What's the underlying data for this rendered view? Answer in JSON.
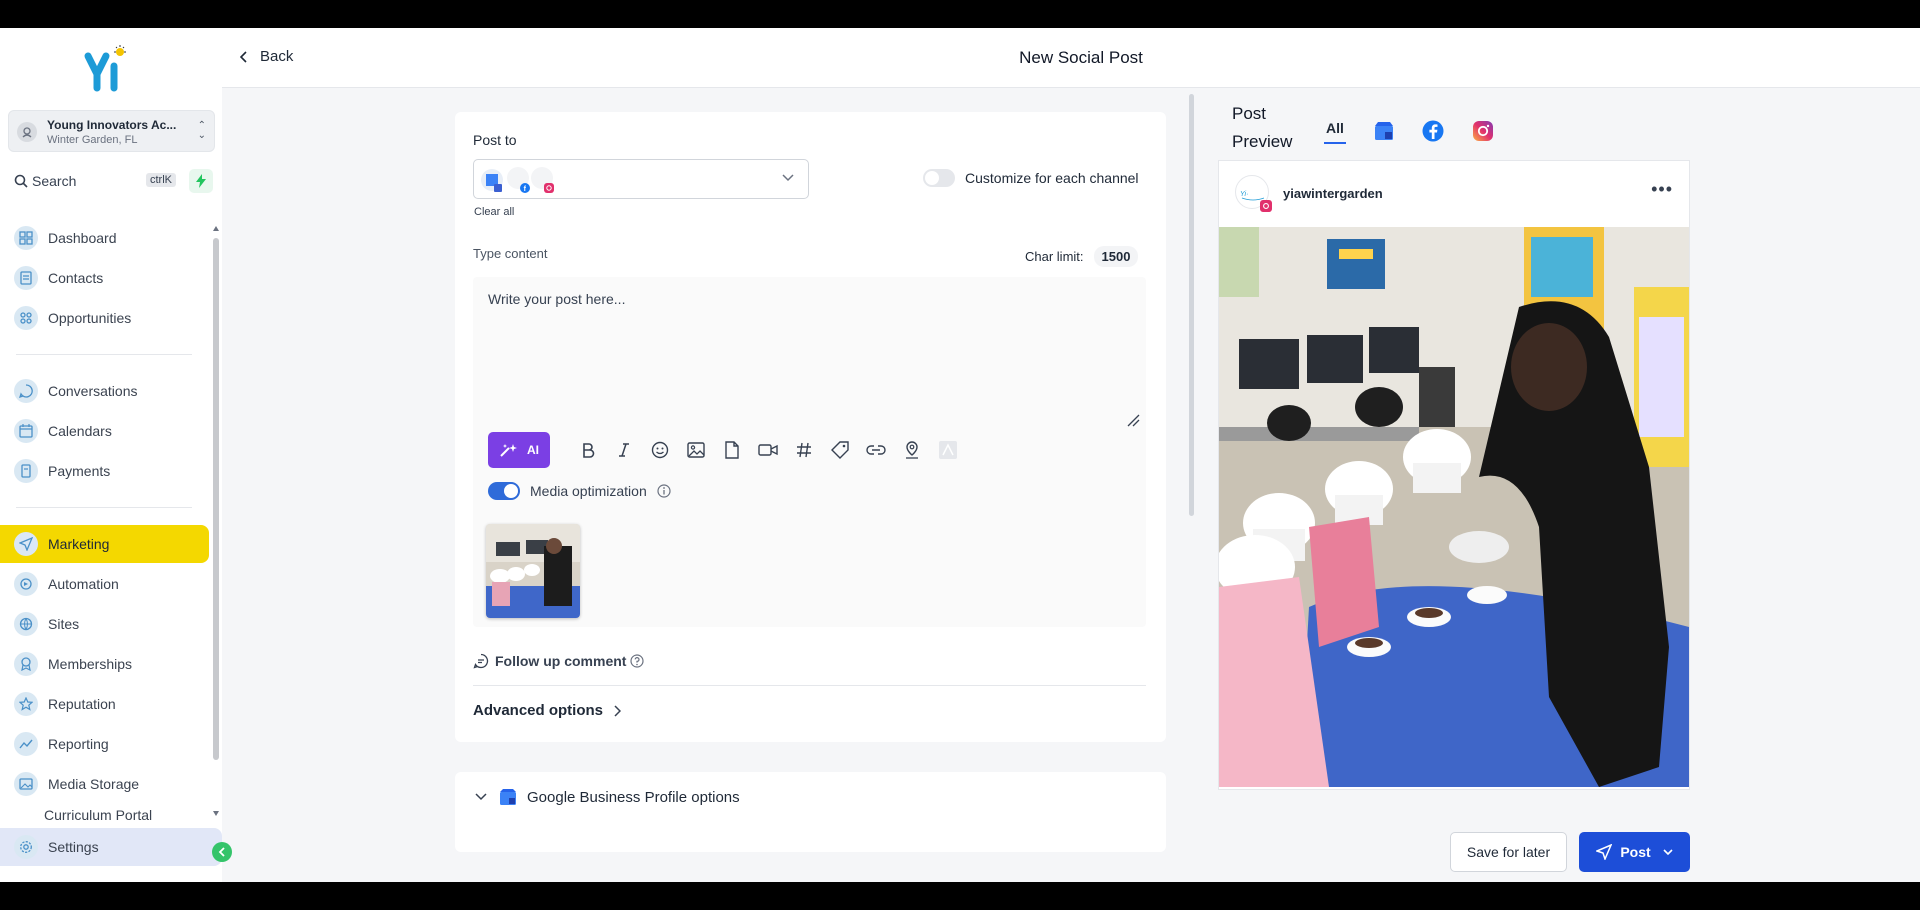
{
  "sidebar": {
    "account": {
      "name": "Young Innovators Ac...",
      "location": "Winter Garden, FL"
    },
    "search": {
      "label": "Search",
      "shortcut": "ctrlK"
    },
    "items": [
      {
        "label": "Dashboard"
      },
      {
        "label": "Contacts"
      },
      {
        "label": "Opportunities"
      },
      {
        "label": "Conversations"
      },
      {
        "label": "Calendars"
      },
      {
        "label": "Payments"
      },
      {
        "label": "Marketing"
      },
      {
        "label": "Automation"
      },
      {
        "label": "Sites"
      },
      {
        "label": "Memberships"
      },
      {
        "label": "Reputation"
      },
      {
        "label": "Reporting"
      },
      {
        "label": "Media Storage"
      },
      {
        "label": "Curriculum Portal"
      }
    ],
    "settings_label": "Settings",
    "active_color": "#f4d800"
  },
  "header": {
    "back_label": "Back",
    "title": "New Social Post"
  },
  "composer": {
    "post_to_label": "Post to",
    "clear_all": "Clear all",
    "customize_label": "Customize for each channel",
    "type_content_label": "Type content",
    "char_limit_label": "Char limit:",
    "char_limit_value": "1500",
    "placeholder": "Write your post here...",
    "ai_label": "AI",
    "media_optimization_label": "Media optimization",
    "follow_up_label": "Follow up comment",
    "advanced_label": "Advanced options",
    "gbp_label": "Google Business Profile options"
  },
  "preview": {
    "title_line1": "Post",
    "title_line2": "Preview",
    "tab_all": "All",
    "username": "yiawintergarden"
  },
  "footer": {
    "save_label": "Save for later",
    "post_label": "Post"
  }
}
